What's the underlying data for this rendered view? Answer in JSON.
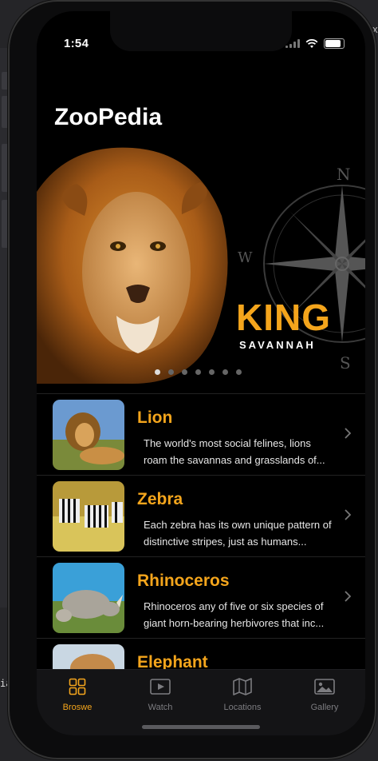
{
  "status": {
    "time": "1:54"
  },
  "app": {
    "title": "ZooPedia"
  },
  "hero": {
    "headline": "KING",
    "subline": "SAVANNAH",
    "page_count": 7,
    "active_page": 1,
    "compass_letters": {
      "n": "N",
      "w": "W",
      "s": "S"
    }
  },
  "animals": [
    {
      "name": "Lion",
      "description": "The world's most social felines, lions roam the savannas and grasslands of..."
    },
    {
      "name": "Zebra",
      "description": "Each zebra has its own unique pattern of distinctive stripes, just as humans..."
    },
    {
      "name": "Rhinoceros",
      "description": "Rhinoceros any of five or six species of giant horn-bearing herbivores that inc..."
    },
    {
      "name": "Elephant",
      "description": ""
    }
  ],
  "tabs": [
    {
      "label": "Broswe",
      "icon": "grid-icon",
      "active": true
    },
    {
      "label": "Watch",
      "icon": "play-icon",
      "active": false
    },
    {
      "label": "Locations",
      "icon": "map-icon",
      "active": false
    },
    {
      "label": "Gallery",
      "icon": "photo-icon",
      "active": false
    }
  ],
  "ide": {
    "left_text": "ia",
    "right_text": "ix"
  },
  "colors": {
    "accent": "#f4a51c",
    "background": "#000000",
    "tab_inactive": "#7c7c80"
  }
}
